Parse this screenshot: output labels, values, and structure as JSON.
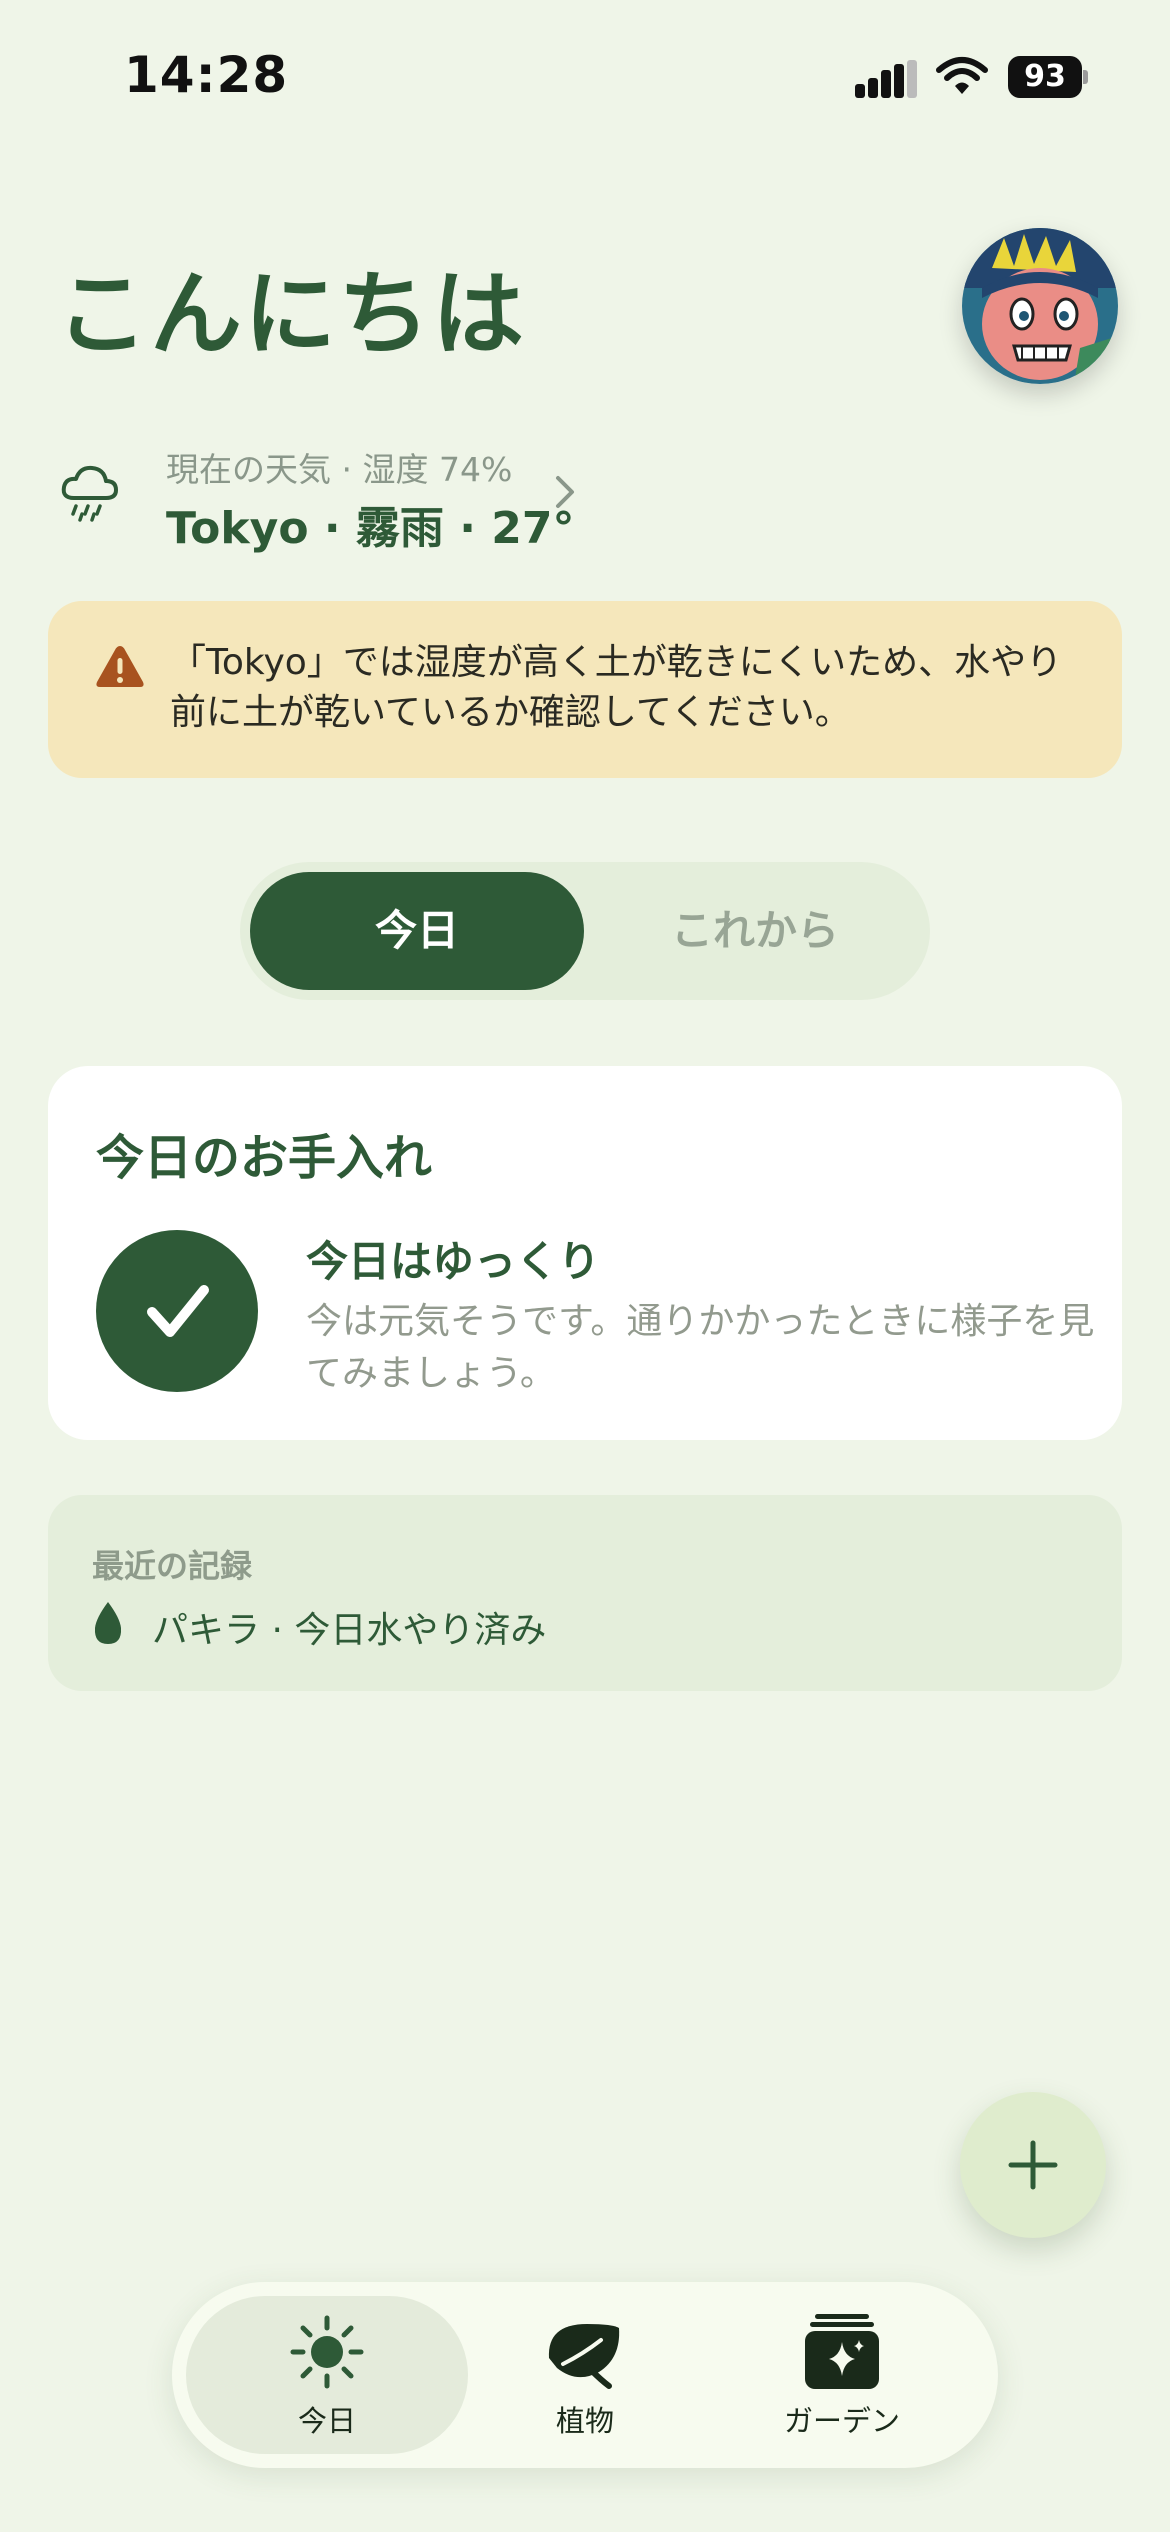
{
  "status_bar": {
    "time": "14:28",
    "battery": "93"
  },
  "greeting": "こんにちは",
  "weather": {
    "subtitle": "現在の天気 · 湿度 74%",
    "main": "Tokyo · 霧雨 · 27°",
    "icon": "cloud-drizzle-icon"
  },
  "warning": {
    "text": "「Tokyo」では湿度が高く土が乾きにくいため、水やり前に土が乾いているか確認してください。",
    "icon": "warning-triangle-icon"
  },
  "segmented": {
    "today": "今日",
    "future": "これから",
    "selected": "today"
  },
  "care": {
    "title": "今日のお手入れ",
    "headline": "今日はゆっくり",
    "description": "今は元気そうです。通りかかったときに様子を見てみましょう。"
  },
  "recent": {
    "label": "最近の記録",
    "item": "パキラ · 今日水やり済み"
  },
  "tabs": [
    {
      "label": "今日",
      "icon": "sun-icon",
      "active": true
    },
    {
      "label": "植物",
      "icon": "leaf-icon",
      "active": false
    },
    {
      "label": "ガーデン",
      "icon": "sparkle-stack-icon",
      "active": false
    }
  ],
  "colors": {
    "primary": "#2e5a37",
    "background": "#eff5e8",
    "warning_bg": "#f5e7bb",
    "warning_icon": "#a8531f"
  }
}
